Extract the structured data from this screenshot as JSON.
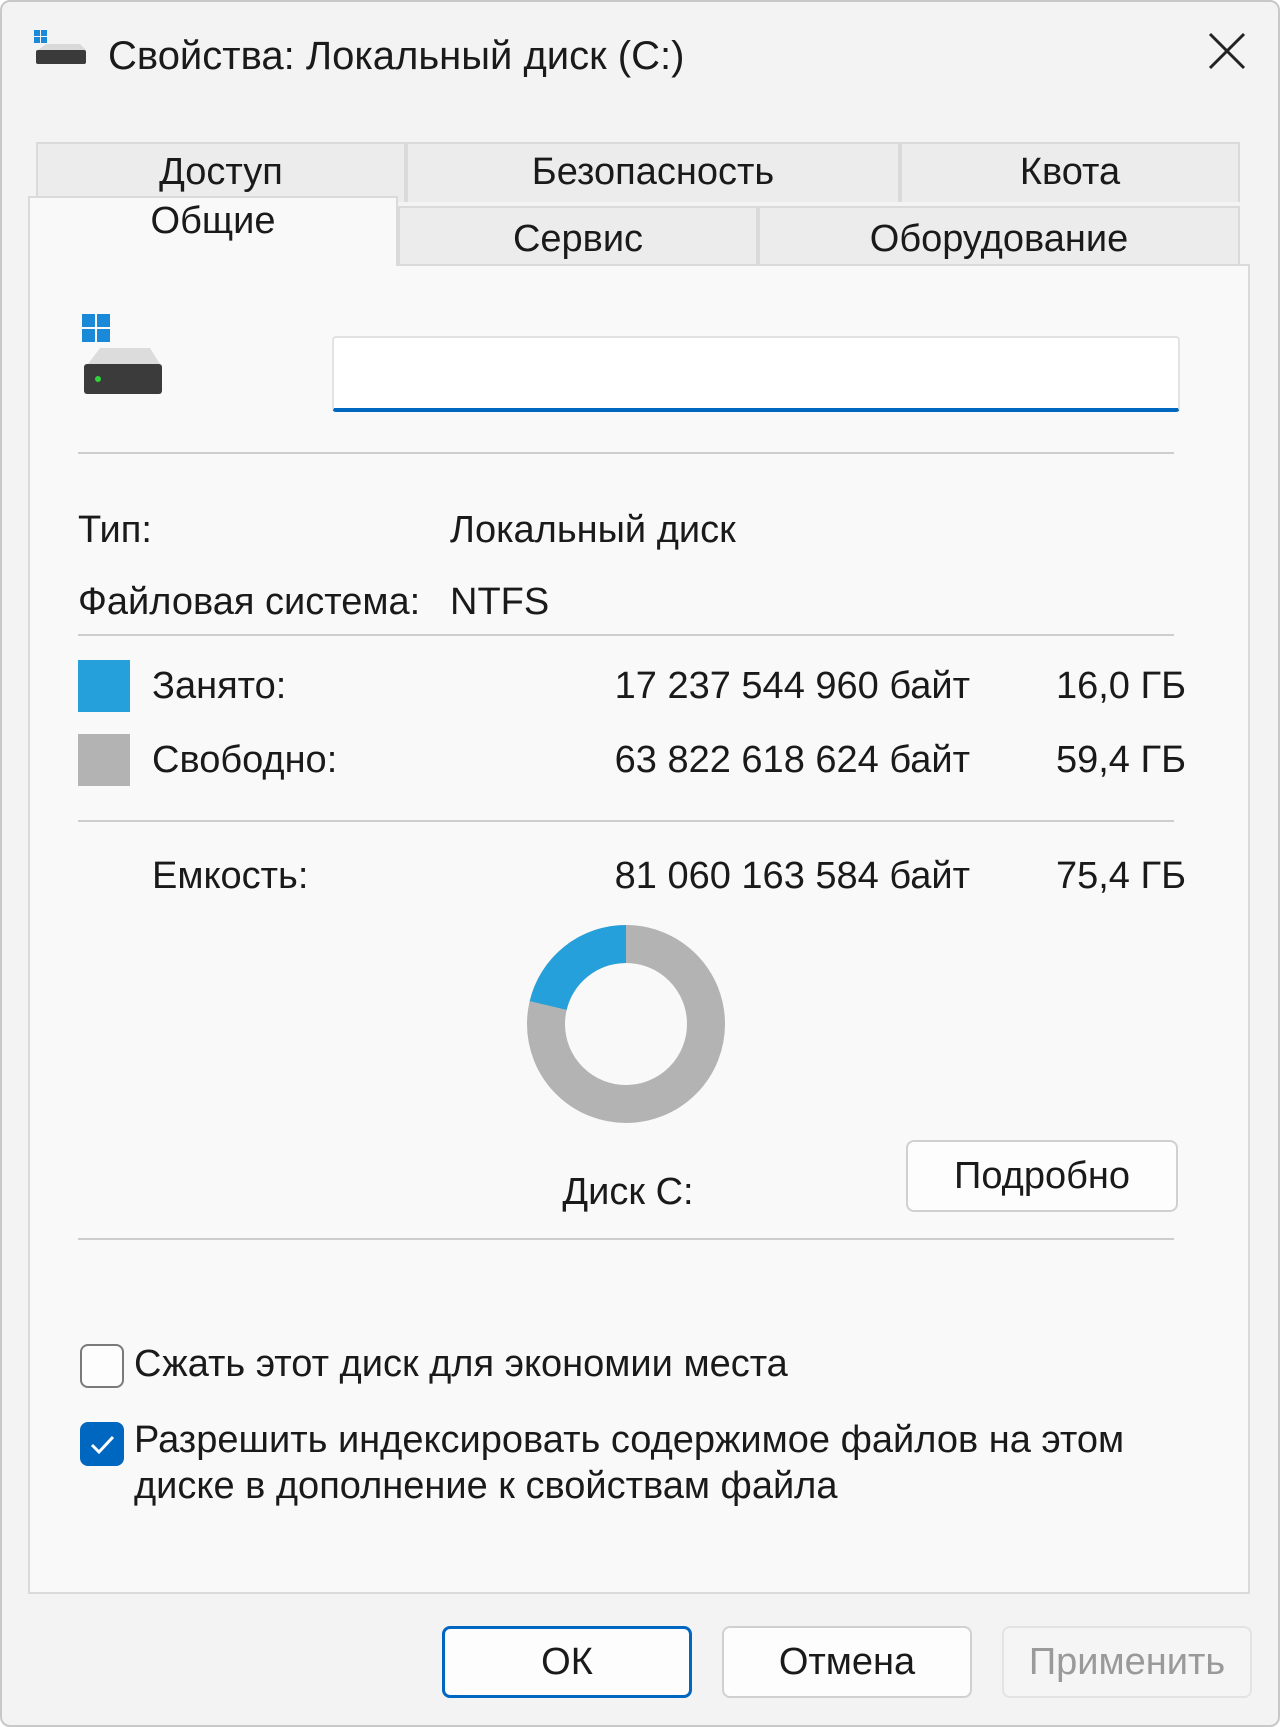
{
  "window": {
    "title": "Свойства: Локальный диск (C:)",
    "icon": "drive-icon",
    "close_icon": "close-icon"
  },
  "tabs": {
    "row_back": [
      {
        "label": "Доступ"
      },
      {
        "label": "Безопасность"
      },
      {
        "label": "Квота"
      }
    ],
    "row_front": [
      {
        "label": "Общие",
        "active": true
      },
      {
        "label": "Сервис"
      },
      {
        "label": "Оборудование"
      }
    ]
  },
  "general": {
    "drive_name_value": "",
    "type_label": "Тип:",
    "type_value": "Локальный диск",
    "fs_label": "Файловая система:",
    "fs_value": "NTFS",
    "used": {
      "label": "Занято:",
      "bytes": "17 237 544 960 байт",
      "size": "16,0 ГБ",
      "color": "#26a0da"
    },
    "free": {
      "label": "Свободно:",
      "bytes": "63 822 618 624 байт",
      "size": "59,4 ГБ",
      "color": "#b3b3b3"
    },
    "capacity": {
      "label": "Емкость:",
      "bytes": "81 060 163 584 байт",
      "size": "75,4 ГБ"
    },
    "donut": {
      "used_fraction": 0.2127
    },
    "disk_label": "Диск C:",
    "details_button": "Подробно",
    "compress": {
      "label": "Сжать этот диск для экономии места",
      "checked": false
    },
    "index": {
      "line1": "Разрешить индексировать содержимое файлов на этом",
      "line2": "диске в дополнение к свойствам файла",
      "checked": true
    }
  },
  "footer": {
    "ok": "ОК",
    "cancel": "Отмена",
    "apply": "Применить"
  },
  "colors": {
    "accent": "#0067c0",
    "used": "#26a0da",
    "free": "#b3b3b3"
  }
}
